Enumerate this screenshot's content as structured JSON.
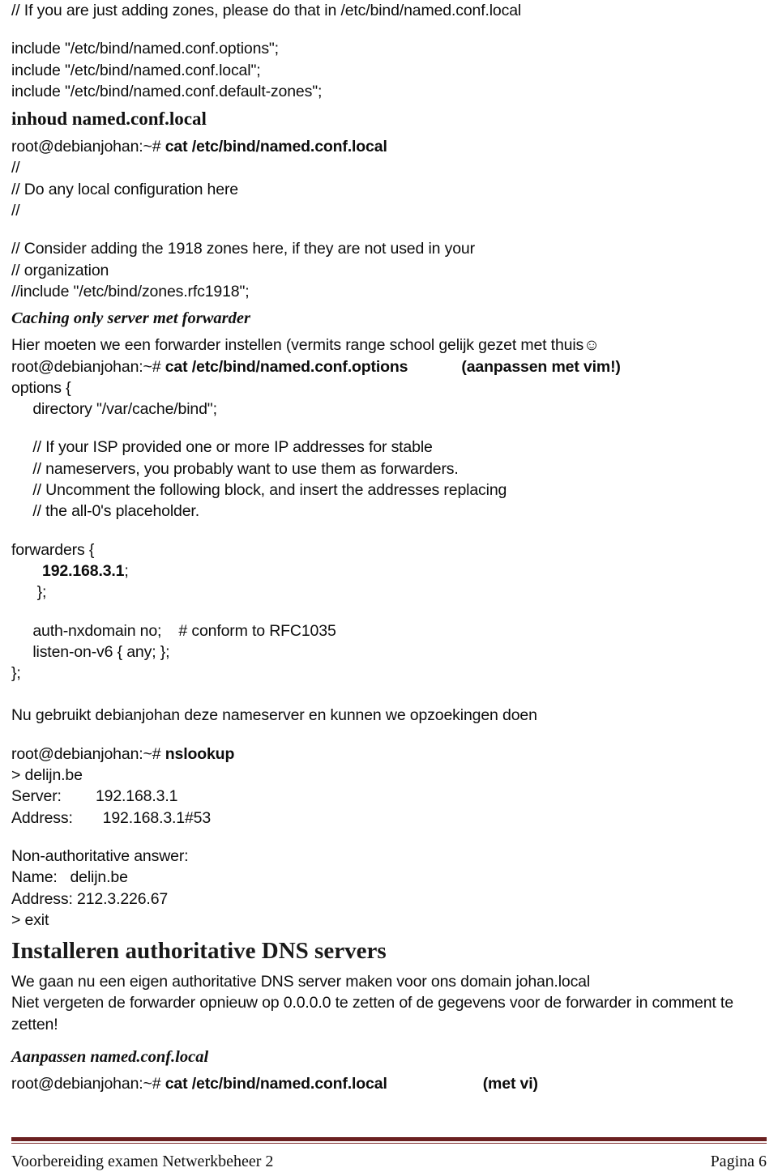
{
  "document": {
    "page_label": "Pagina 6",
    "footer_title": "Voorbereiding examen Netwerkbeheer 2",
    "accent_color": "#6b2020"
  },
  "content": {
    "intro_comment": "// If you are just adding zones, please do that in /etc/bind/named.conf.local",
    "includes": [
      "include \"/etc/bind/named.conf.options\";",
      "include \"/etc/bind/named.conf.local\";",
      "include \"/etc/bind/named.conf.default-zones\";"
    ],
    "heading_inhoud": "inhoud named.conf.local",
    "cmd_cat_local": {
      "prompt": "root@debianjohan:~# ",
      "command": "cat /etc/bind/named.conf.local"
    },
    "named_conf_local_body": [
      "//",
      "// Do any local configuration here",
      "//"
    ],
    "named_conf_local_body2": [
      "// Consider adding the 1918 zones here, if they are not used in your",
      "// organization",
      "//include \"/etc/bind/zones.rfc1918\";"
    ],
    "heading_caching": "Caching only server met forwarder",
    "caching_intro": "Hier moeten we een forwarder instellen (vermits range school gelijk gezet met thuis☺",
    "cmd_cat_options": {
      "prompt": "root@debianjohan:~# ",
      "command": "cat /etc/bind/named.conf.options",
      "note": "(aanpassen met vim!)"
    },
    "options_open": "options {",
    "options_directory": "     directory \"/var/cache/bind\";",
    "isp_comments": [
      "     // If your ISP provided one or more IP addresses for stable",
      "     // nameservers, you probably want to use them as forwarders.",
      "     // Uncomment the following block, and insert the addresses replacing",
      "     // the all-0's placeholder."
    ],
    "forwarders_open": "forwarders {",
    "forwarder_ip": "192.168.3.1",
    "forwarder_ip_semicolon": ";",
    "forwarders_close": "      };",
    "auth_nxdomain": "     auth-nxdomain no;    # conform to RFC1035",
    "listen_on_v6": "     listen-on-v6 { any; };",
    "options_close": "};",
    "nameserver_note": "Nu gebruikt debianjohan deze nameserver en kunnen we opzoekingen doen",
    "cmd_nslookup": {
      "prompt": "root@debianjohan:~# ",
      "command": "nslookup"
    },
    "nslookup_query": "> delijn.be",
    "nslookup_server": "Server:        192.168.3.1",
    "nslookup_address": "Address:       192.168.3.1#53",
    "nslookup_answer_header": "Non-authoritative answer:",
    "nslookup_name": "Name:   delijn.be",
    "nslookup_addr_result": "Address: 212.3.226.67",
    "nslookup_exit": "> exit",
    "heading_installeren": "Installeren authoritative DNS servers",
    "installeren_para1": "We gaan nu een eigen authoritative DNS server maken voor ons domain johan.local",
    "installeren_para2": "Niet vergeten de forwarder opnieuw op 0.0.0.0 te zetten of de gegevens voor de forwarder in comment te zetten!",
    "heading_aanpassen": "Aanpassen named.conf.local",
    "cmd_cat_local2": {
      "prompt": "root@debianjohan:~# ",
      "command": "cat /etc/bind/named.conf.local",
      "note": "(met vi)"
    }
  }
}
